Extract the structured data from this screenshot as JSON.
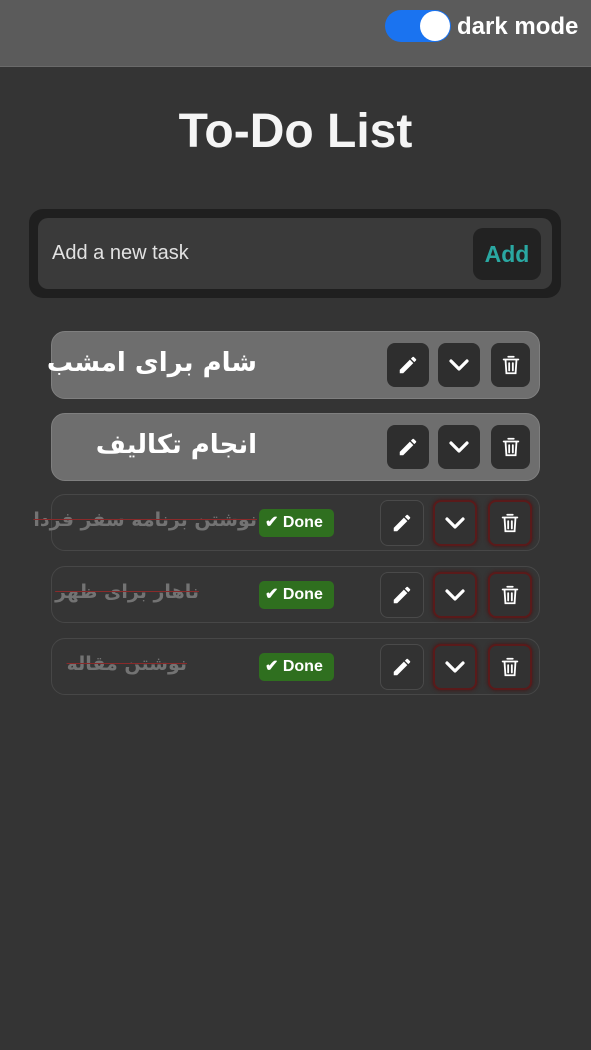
{
  "header": {
    "toggle_label": "dark mode",
    "toggle_on": true,
    "toggle_color": "#1a73f0"
  },
  "title": "To-Do List",
  "add_task": {
    "placeholder": "Add a new task",
    "button_label": "Add",
    "button_color": "#2aa8a2"
  },
  "tasks": [
    {
      "text": "شام برای امشب",
      "done": false
    },
    {
      "text": "انجام تکالیف",
      "done": false
    },
    {
      "text": "نوشتن برنامه سفر فردا",
      "done": true,
      "badge": "✔ Done"
    },
    {
      "text": "ناهار برای ظهر",
      "done": true,
      "badge": "✔ Done"
    },
    {
      "text": "نوشتن مقاله",
      "done": true,
      "badge": "✔ Done"
    }
  ],
  "icons": {
    "edit": "pencil-icon",
    "expand": "chevron-down-icon",
    "delete": "trash-icon"
  },
  "colors": {
    "background": "#343434",
    "done_badge": "#2f6f1f"
  }
}
